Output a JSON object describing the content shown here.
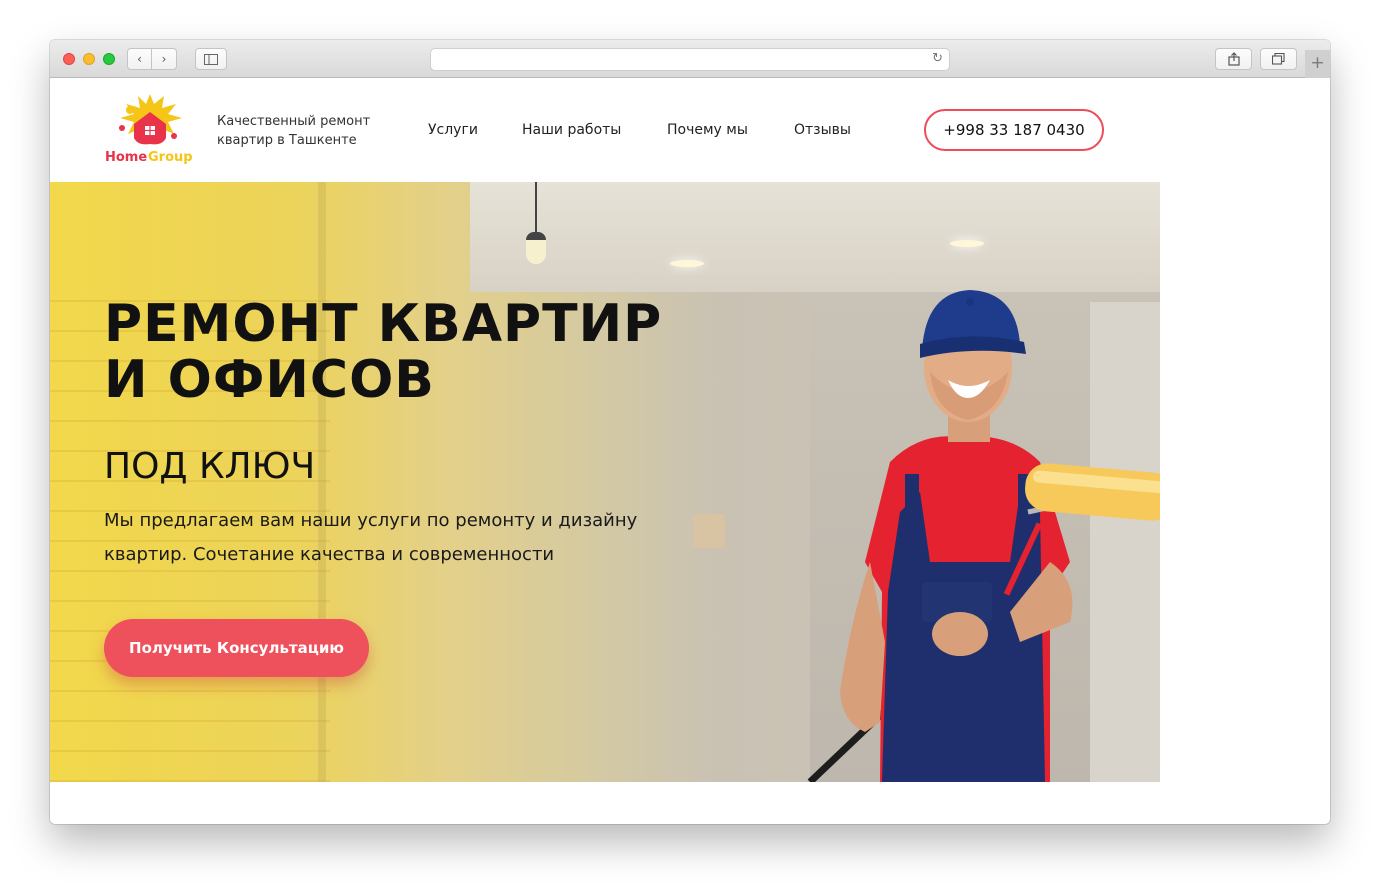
{
  "browser": {
    "back_glyph": "‹",
    "forward_glyph": "›",
    "reload_glyph": "↻",
    "new_tab_glyph": "+"
  },
  "header": {
    "logo_text_1": "Home",
    "logo_text_2": "Group",
    "tagline": "Качественный ремонт квартир в Ташкенте",
    "nav": [
      "Услуги",
      "Наши работы",
      "Почему мы",
      "Отзывы"
    ],
    "phone": "+998 33 187 0430"
  },
  "hero": {
    "title_line1": "РЕМОНТ КВАРТИР",
    "title_line2": "И ОФИСОВ",
    "subtitle": "ПОД КЛЮЧ",
    "description": "Мы предлагаем вам наши услуги по ремонту и дизайну квартир. Сочетание качества и современности",
    "cta_label": "Получить Консультацию"
  },
  "colors": {
    "accent": "#ee505c",
    "hero_yellow": "#f2d84a",
    "logo_red": "#e8334a",
    "logo_yellow": "#f5c518"
  }
}
